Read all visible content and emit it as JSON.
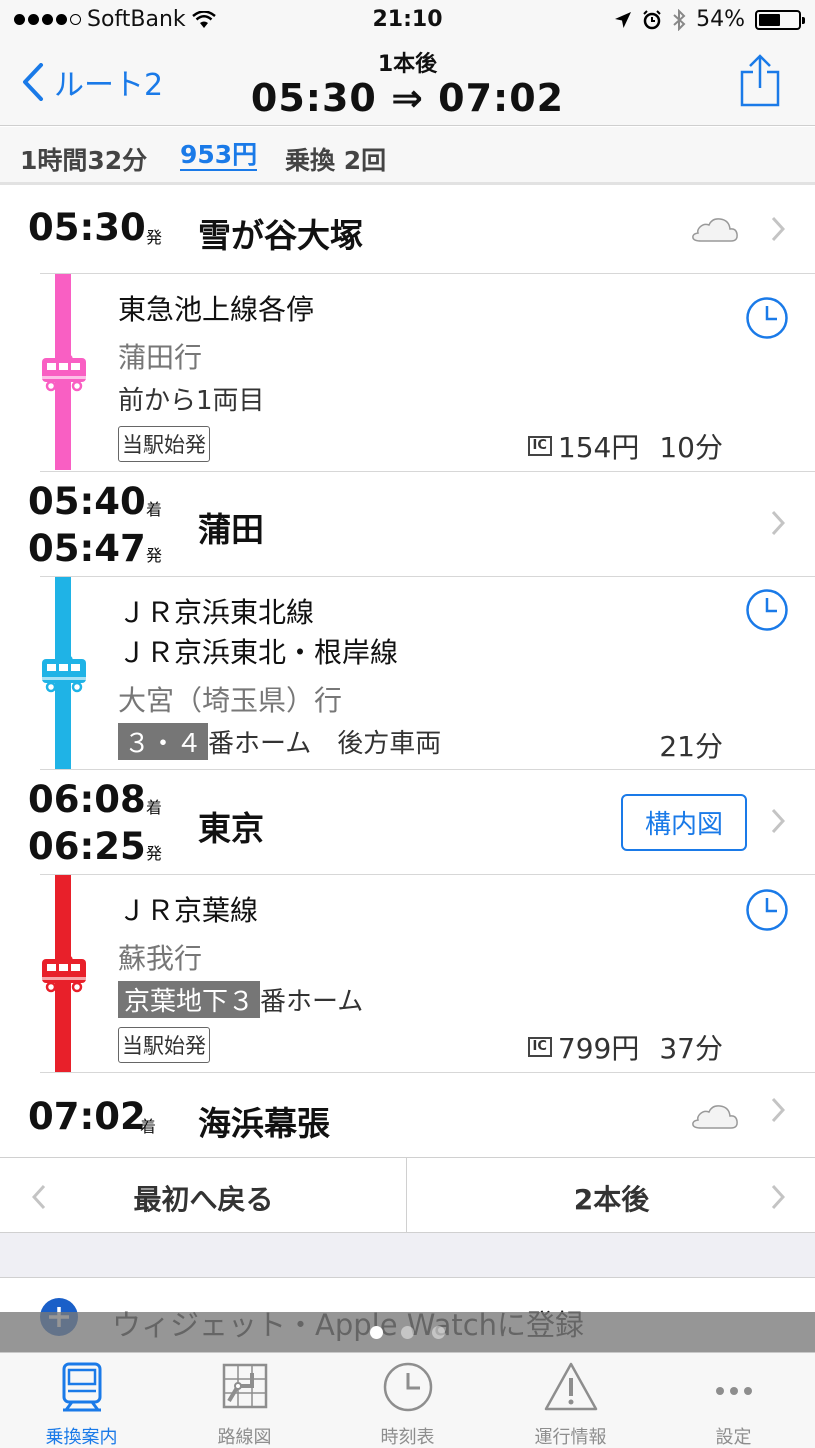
{
  "status": {
    "carrier": "SoftBank",
    "time": "21:10",
    "battery": "54%",
    "battery_level": 0.54
  },
  "nav": {
    "back_label": "ルート2",
    "subtitle": "1本後",
    "title": "05:30 ⇒ 07:02"
  },
  "summary": {
    "duration": "1時間32分",
    "fare": "953円",
    "transfers": "乗換 2回"
  },
  "stations": [
    {
      "time1": "05:30",
      "suffix1": "発",
      "name": "雪が谷大塚"
    },
    {
      "time1": "05:40",
      "suffix1": "着",
      "time2": "05:47",
      "suffix2": "発",
      "name": "蒲田"
    },
    {
      "time1": "06:08",
      "suffix1": "着",
      "time2": "06:25",
      "suffix2": "発",
      "name": "東京",
      "map_button": "構内図"
    },
    {
      "time1": "07:02",
      "suffix1": "着",
      "name": "海浜幕張"
    }
  ],
  "legs": [
    {
      "color": "#f95fc3",
      "line": "東急池上線各停",
      "destination": "蒲田行",
      "car": "前から1両目",
      "badge": "当駅始発",
      "ic_label": "IC",
      "fare": "154円",
      "duration": "10分"
    },
    {
      "color": "#1fb3e6",
      "line": "ＪＲ京浜東北線",
      "line2": "ＪＲ京浜東北・根岸線",
      "destination": "大宮（埼玉県）行",
      "platform": "３・４",
      "platform_suffix": "番ホーム　後方車両",
      "duration": "21分"
    },
    {
      "color": "#e8202a",
      "line": "ＪＲ京葉線",
      "destination": "蘇我行",
      "platform": "京葉地下３",
      "platform_suffix": "番ホーム",
      "badge": "当駅始発",
      "ic_label": "IC",
      "fare": "799円",
      "duration": "37分"
    }
  ],
  "bottom": {
    "first_label": "最初へ戻る",
    "next_label": "2本後"
  },
  "widget": {
    "label": "ウィジェット・Apple Watchに登録"
  },
  "tabs": [
    {
      "label": "乗換案内",
      "icon": "train-icon",
      "active": true
    },
    {
      "label": "路線図",
      "icon": "route-map-icon"
    },
    {
      "label": "時刻表",
      "icon": "clock-icon"
    },
    {
      "label": "運行情報",
      "icon": "warning-icon"
    },
    {
      "label": "設定",
      "icon": "more-icon"
    }
  ],
  "colors": {
    "accent": "#1a7ae8"
  }
}
